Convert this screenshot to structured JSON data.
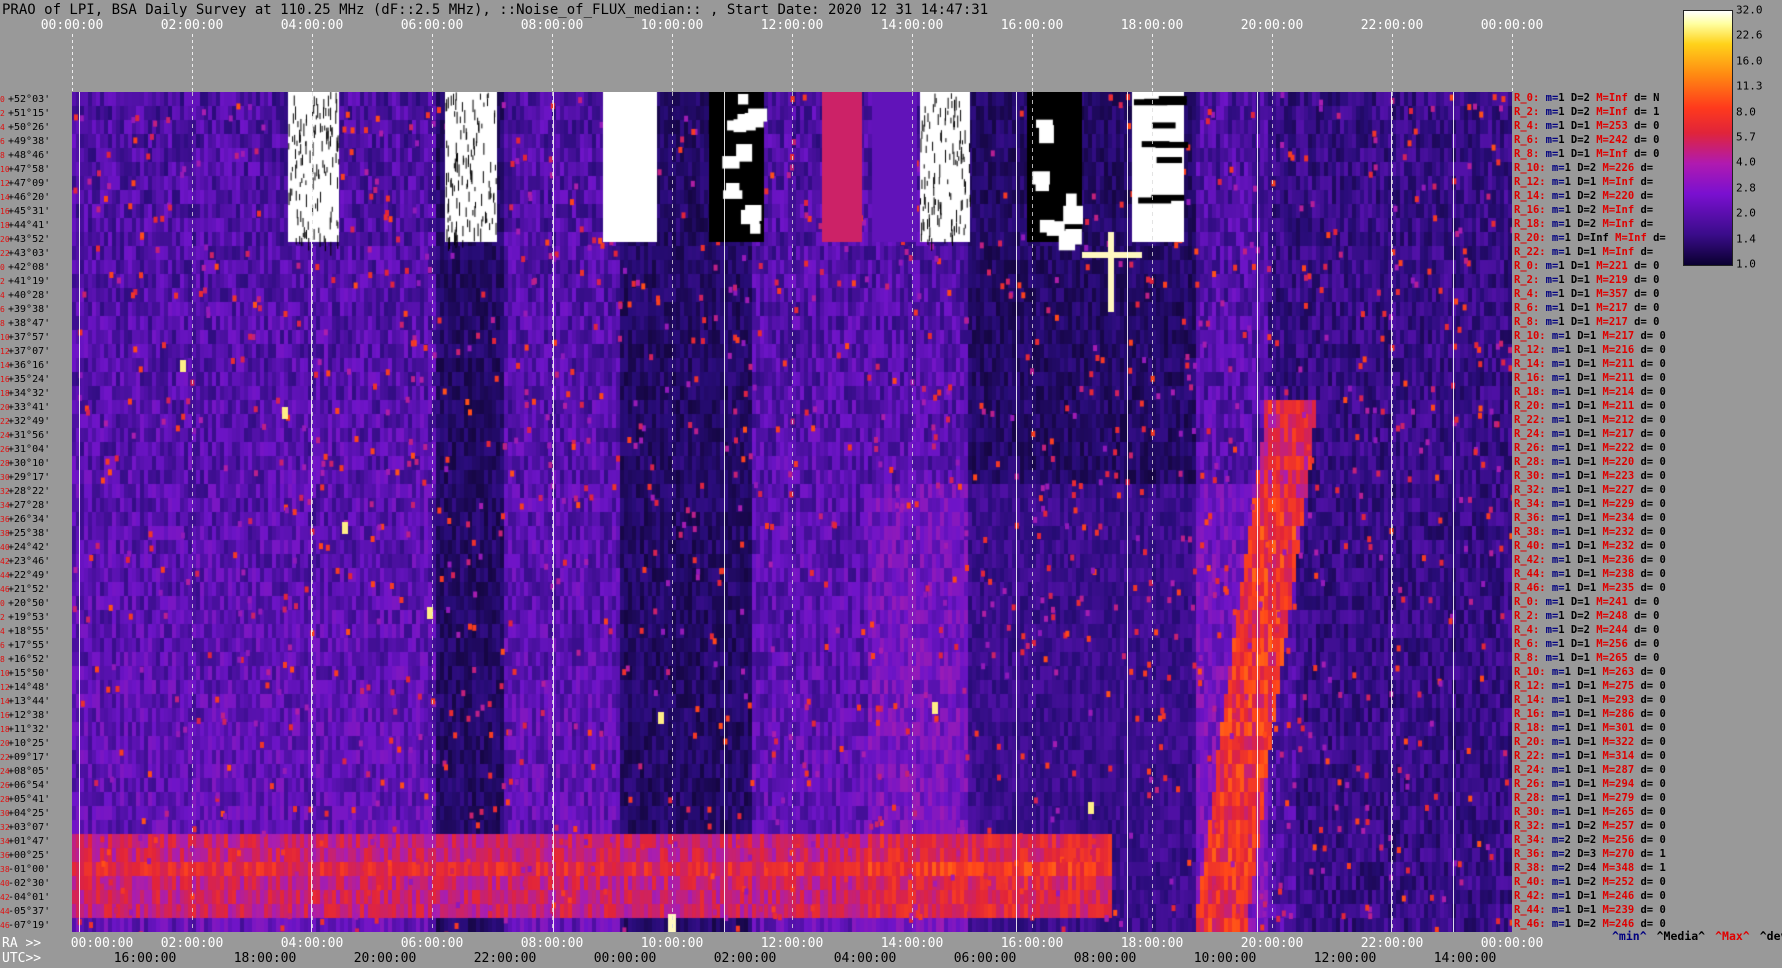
{
  "title": "PRAO of LPI, BSA Daily Survey at 110.25 MHz (dF::2.5 MHz), ::Noise_of_FLUX_median:: , Start Date: 2020 12 31 14:47:31",
  "chart_data": {
    "type": "heatmap",
    "title": "PRAO of LPI, BSA Daily Survey at 110.25 MHz (dF::2.5 MHz), ::Noise_of_FLUX_median:: , Start Date: 2020 12 31 14:47:31",
    "x_top_ticks": [
      "00:00:00",
      "02:00:00",
      "04:00:00",
      "06:00:00",
      "08:00:00",
      "10:00:00",
      "12:00:00",
      "14:00:00",
      "16:00:00",
      "18:00:00",
      "20:00:00",
      "22:00:00",
      "00:00:00"
    ],
    "x_ra_label": "RA >>",
    "x_ra_ticks": [
      "00:00:00",
      "02:00:00",
      "04:00:00",
      "06:00:00",
      "08:00:00",
      "10:00:00",
      "12:00:00",
      "14:00:00",
      "16:00:00",
      "18:00:00",
      "20:00:00",
      "22:00:00",
      "00:00:00"
    ],
    "x_utc_label": "UTC>>",
    "x_utc_ticks": [
      "16:00:00",
      "18:00:00",
      "20:00:00",
      "22:00:00",
      "00:00:00",
      "02:00:00",
      "04:00:00",
      "06:00:00",
      "08:00:00",
      "10:00:00",
      "12:00:00",
      "14:00:00"
    ],
    "y_declinations": [
      "+52°03'",
      "+51°15'",
      "+50°26'",
      "+49°38'",
      "+48°46'",
      "+47°58'",
      "+47°09'",
      "+46°20'",
      "+45°31'",
      "+44°41'",
      "+43°52'",
      "+43°03'",
      "+42°08'",
      "+41°19'",
      "+40°28'",
      "+39°38'",
      "+38°47'",
      "+37°57'",
      "+37°07'",
      "+36°16'",
      "+35°24'",
      "+34°32'",
      "+33°41'",
      "+32°49'",
      "+31°56'",
      "+31°04'",
      "+30°10'",
      "+29°17'",
      "+28°22'",
      "+27°28'",
      "+26°34'",
      "+25°38'",
      "+24°42'",
      "+23°46'",
      "+22°49'",
      "+21°52'",
      "+20°50'",
      "+19°53'",
      "+18°55'",
      "+17°55'",
      "+16°52'",
      "+15°50'",
      "+14°48'",
      "+13°44'",
      "+12°38'",
      "+11°32'",
      "+10°25'",
      "+09°17'",
      "+08°05'",
      "+06°54'",
      "+05°41'",
      "+04°25'",
      "+03°07'",
      "+01°47'",
      "+00°25'",
      "-01°00'",
      "-02°30'",
      "-04°01'",
      "-05°37'",
      "-07°19'"
    ],
    "row_index_labels": [
      "0",
      "2",
      "4",
      "6",
      "8",
      "10",
      "12",
      "14",
      "16",
      "18",
      "20",
      "22",
      "0",
      "2",
      "4",
      "6",
      "8",
      "10",
      "12",
      "14",
      "16",
      "18",
      "20",
      "22",
      "24",
      "26",
      "28",
      "30",
      "32",
      "34",
      "36",
      "38",
      "40",
      "42",
      "44",
      "46",
      "0",
      "2",
      "4",
      "6",
      "8",
      "10",
      "12",
      "14",
      "16",
      "18",
      "20",
      "22",
      "24",
      "26",
      "28",
      "30",
      "32",
      "34",
      "36",
      "38",
      "40",
      "42",
      "44",
      "46"
    ],
    "colorbar": {
      "ticks": [
        "32.0",
        "22.6",
        "16.0",
        "11.3",
        "8.0",
        "5.7",
        "4.0",
        "2.8",
        "2.0",
        "1.4",
        "1.0"
      ],
      "min": 1.0,
      "max": 32.0,
      "scale": "log",
      "colors": [
        "#0a0030",
        "#3a0c8a",
        "#7a10d0",
        "#b01ab0",
        "#e0243a",
        "#ff3a1c",
        "#ff8a12",
        "#ffd21a",
        "#ffffa0",
        "#ffffff"
      ]
    },
    "right_stats": [
      [
        "R_0:",
        "1",
        "2",
        "Inf",
        "N"
      ],
      [
        "R_2:",
        "1",
        "2",
        "Inf",
        "1"
      ],
      [
        "R_4:",
        "1",
        "1",
        "253",
        "0"
      ],
      [
        "R_6:",
        "1",
        "2",
        "242",
        "0"
      ],
      [
        "R_8:",
        "1",
        "1",
        "Inf",
        "0"
      ],
      [
        "R_10:",
        "1",
        "2",
        "226",
        ""
      ],
      [
        "R_12:",
        "1",
        "1",
        "Inf",
        ""
      ],
      [
        "R_14:",
        "1",
        "2",
        "220",
        ""
      ],
      [
        "R_16:",
        "1",
        "2",
        "Inf",
        ""
      ],
      [
        "R_18:",
        "1",
        "2",
        "Inf",
        ""
      ],
      [
        "R_20:",
        "1",
        "Inf",
        "Inf",
        ""
      ],
      [
        "R_22:",
        "1",
        "1",
        "Inf",
        ""
      ],
      [
        "R_0:",
        "1",
        "1",
        "221",
        "0"
      ],
      [
        "R_2:",
        "1",
        "1",
        "219",
        "0"
      ],
      [
        "R_4:",
        "1",
        "1",
        "357",
        "0"
      ],
      [
        "R_6:",
        "1",
        "1",
        "217",
        "0"
      ],
      [
        "R_8:",
        "1",
        "1",
        "217",
        "0"
      ],
      [
        "R_10:",
        "1",
        "1",
        "217",
        "0"
      ],
      [
        "R_12:",
        "1",
        "1",
        "216",
        "0"
      ],
      [
        "R_14:",
        "1",
        "1",
        "211",
        "0"
      ],
      [
        "R_16:",
        "1",
        "1",
        "211",
        "0"
      ],
      [
        "R_18:",
        "1",
        "1",
        "214",
        "0"
      ],
      [
        "R_20:",
        "1",
        "1",
        "211",
        "0"
      ],
      [
        "R_22:",
        "1",
        "1",
        "212",
        "0"
      ],
      [
        "R_24:",
        "1",
        "1",
        "217",
        "0"
      ],
      [
        "R_26:",
        "1",
        "1",
        "222",
        "0"
      ],
      [
        "R_28:",
        "1",
        "1",
        "220",
        "0"
      ],
      [
        "R_30:",
        "1",
        "1",
        "223",
        "0"
      ],
      [
        "R_32:",
        "1",
        "1",
        "227",
        "0"
      ],
      [
        "R_34:",
        "1",
        "1",
        "229",
        "0"
      ],
      [
        "R_36:",
        "1",
        "1",
        "234",
        "0"
      ],
      [
        "R_38:",
        "1",
        "1",
        "232",
        "0"
      ],
      [
        "R_40:",
        "1",
        "1",
        "232",
        "0"
      ],
      [
        "R_42:",
        "1",
        "1",
        "236",
        "0"
      ],
      [
        "R_44:",
        "1",
        "1",
        "238",
        "0"
      ],
      [
        "R_46:",
        "1",
        "1",
        "235",
        "0"
      ],
      [
        "R_0:",
        "1",
        "1",
        "241",
        "0"
      ],
      [
        "R_2:",
        "1",
        "2",
        "248",
        "0"
      ],
      [
        "R_4:",
        "1",
        "2",
        "244",
        "0"
      ],
      [
        "R_6:",
        "1",
        "1",
        "256",
        "0"
      ],
      [
        "R_8:",
        "1",
        "1",
        "265",
        "0"
      ],
      [
        "R_10:",
        "1",
        "1",
        "263",
        "0"
      ],
      [
        "R_12:",
        "1",
        "1",
        "275",
        "0"
      ],
      [
        "R_14:",
        "1",
        "1",
        "293",
        "0"
      ],
      [
        "R_16:",
        "1",
        "1",
        "286",
        "0"
      ],
      [
        "R_18:",
        "1",
        "1",
        "301",
        "0"
      ],
      [
        "R_20:",
        "1",
        "1",
        "322",
        "0"
      ],
      [
        "R_22:",
        "1",
        "1",
        "314",
        "0"
      ],
      [
        "R_24:",
        "1",
        "1",
        "287",
        "0"
      ],
      [
        "R_26:",
        "1",
        "1",
        "294",
        "0"
      ],
      [
        "R_28:",
        "1",
        "1",
        "279",
        "0"
      ],
      [
        "R_30:",
        "1",
        "1",
        "265",
        "0"
      ],
      [
        "R_32:",
        "1",
        "2",
        "257",
        "0"
      ],
      [
        "R_34:",
        "2",
        "2",
        "256",
        "0"
      ],
      [
        "R_36:",
        "2",
        "3",
        "270",
        "1"
      ],
      [
        "R_38:",
        "2",
        "4",
        "348",
        "1"
      ],
      [
        "R_40:",
        "1",
        "2",
        "252",
        "0"
      ],
      [
        "R_42:",
        "1",
        "1",
        "246",
        "0"
      ],
      [
        "R_44:",
        "1",
        "1",
        "239",
        "0"
      ],
      [
        "R_46:",
        "1",
        "2",
        "246",
        "0"
      ]
    ],
    "legend": [
      "^min^",
      "^Media^",
      "^Max^",
      "^devia^"
    ],
    "legend_colors": [
      "#000080",
      "#000000",
      "#e00000",
      "#000000"
    ]
  }
}
